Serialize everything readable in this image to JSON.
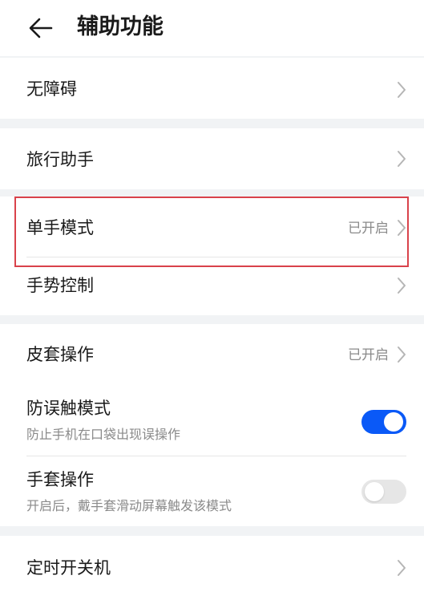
{
  "header": {
    "back_icon": "arrow-left-icon",
    "title": "辅助功能"
  },
  "items": {
    "accessibility": {
      "label": "无障碍"
    },
    "travel_assistant": {
      "label": "旅行助手"
    },
    "one_hand_mode": {
      "label": "单手模式",
      "status": "已开启"
    },
    "gesture_control": {
      "label": "手势控制"
    },
    "cover_operation": {
      "label": "皮套操作",
      "status": "已开启"
    },
    "anti_mistouch": {
      "label": "防误触模式",
      "subtitle": "防止手机在口袋出现误操作",
      "enabled": true
    },
    "glove_mode": {
      "label": "手套操作",
      "subtitle": "开启后，戴手套滑动屏幕触发该模式",
      "enabled": false
    },
    "scheduled_power": {
      "label": "定时开关机"
    }
  },
  "colors": {
    "accent": "#0a59f7",
    "highlight": "#d9424b",
    "background": "#f1f3f5"
  }
}
